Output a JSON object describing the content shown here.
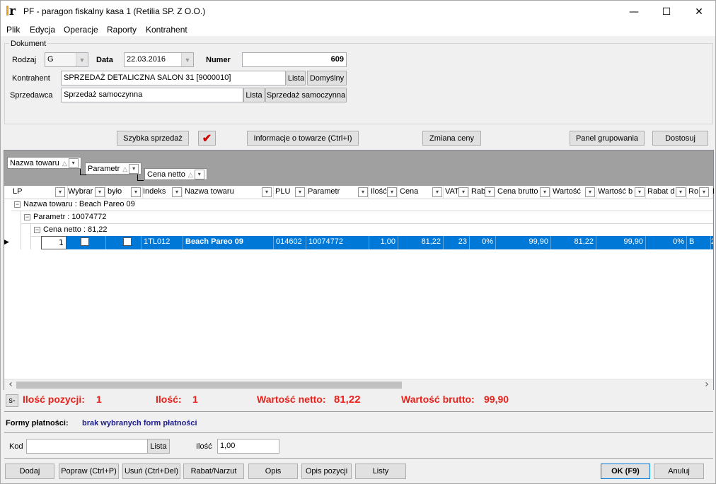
{
  "window": {
    "title": "PF - paragon fiskalny kasa 1 (Retilia SP. Z O.O.)",
    "minimize": "—",
    "maximize": "☐",
    "close": "✕"
  },
  "menu": [
    "Plik",
    "Edycja",
    "Operacje",
    "Raporty",
    "Kontrahent"
  ],
  "dokument": {
    "group_label": "Dokument",
    "rodzaj_label": "Rodzaj",
    "rodzaj_value": "G",
    "data_label": "Data",
    "data_value": "22.03.2016",
    "numer_label": "Numer",
    "numer_value": "609",
    "kontrahent_label": "Kontrahent",
    "kontrahent_value": "SPRZEDAŻ DETALICZNA SALON 31 [9000010]",
    "kontrahent_lista": "Lista",
    "kontrahent_domyslny": "Domyślny",
    "sprzedawca_label": "Sprzedawca",
    "sprzedawca_value": "Sprzedaż samoczynna",
    "sprzedawca_lista": "Lista",
    "sprzedawca_btn": "Sprzedaż samoczynna"
  },
  "toolbar": {
    "szybka": "Szybka sprzedaż",
    "check": "✔",
    "informacje": "Informacje o towarze (Ctrl+I)",
    "zmiana": "Zmiana ceny",
    "panel": "Panel grupowania",
    "dostosuj": "Dostosuj"
  },
  "grouping": {
    "chips": [
      "Nazwa towaru",
      "Parametr",
      "Cena netto"
    ],
    "sort_glyph": "△",
    "drop_glyph": "▾"
  },
  "columns": [
    "LP",
    "Wybrar",
    "było",
    "Indeks",
    "Nazwa towaru",
    "PLU",
    "Parametr",
    "Ilość",
    "Cena",
    "VAT",
    "Rab",
    "Cena brutto",
    "Wartość",
    "Wartość b",
    "Rabat d",
    "Ro",
    "D"
  ],
  "groups": {
    "g1": "Nazwa towaru : Beach Pareo 09",
    "g2": "Parametr : 10074772",
    "g3": "Cena netto : 81,22",
    "expander": "−"
  },
  "row": {
    "pointer": "▶",
    "lp": "1",
    "indeks": "1TL012",
    "nazwa": "Beach Pareo 09",
    "plu": "014602",
    "parametr": "10074772",
    "ilosc": "1,00",
    "cena": "81,22",
    "vat": "23",
    "rabat": "0%",
    "cena_brutto": "99,90",
    "wartosc": "81,22",
    "wartosc_b": "99,90",
    "rabat_d": "0%",
    "ro": "B",
    "d": "2"
  },
  "scroll": {
    "left": "‹",
    "right": "›"
  },
  "summary": {
    "s_btn": "s-",
    "pozycji_label": "Ilość pozycji:",
    "pozycji_value": "1",
    "ilosc_label": "Ilość:",
    "ilosc_value": "1",
    "netto_label": "Wartość netto:",
    "netto_value": "81,22",
    "brutto_label": "Wartość brutto:",
    "brutto_value": "99,90"
  },
  "platnosci": {
    "label": "Formy płatności:",
    "value": "brak wybranych form płatności"
  },
  "kod": {
    "label": "Kod",
    "value": "",
    "lista": "Lista",
    "ilosc_label": "Ilość",
    "ilosc_value": "1,00"
  },
  "bottom": {
    "dodaj": "Dodaj",
    "popraw": "Popraw (Ctrl+P)",
    "usun": "Usuń (Ctrl+Del)",
    "rabat": "Rabat/Narzut",
    "opis": "Opis",
    "opis_pozycji": "Opis pozycji",
    "listy": "Listy",
    "ok": "OK (F9)",
    "anuluj": "Anuluj"
  },
  "colors": {
    "selection": "#0078d7",
    "summary_red": "#e8221b",
    "payment_blue": "#1c1c8c",
    "check_red": "#cc0000"
  }
}
